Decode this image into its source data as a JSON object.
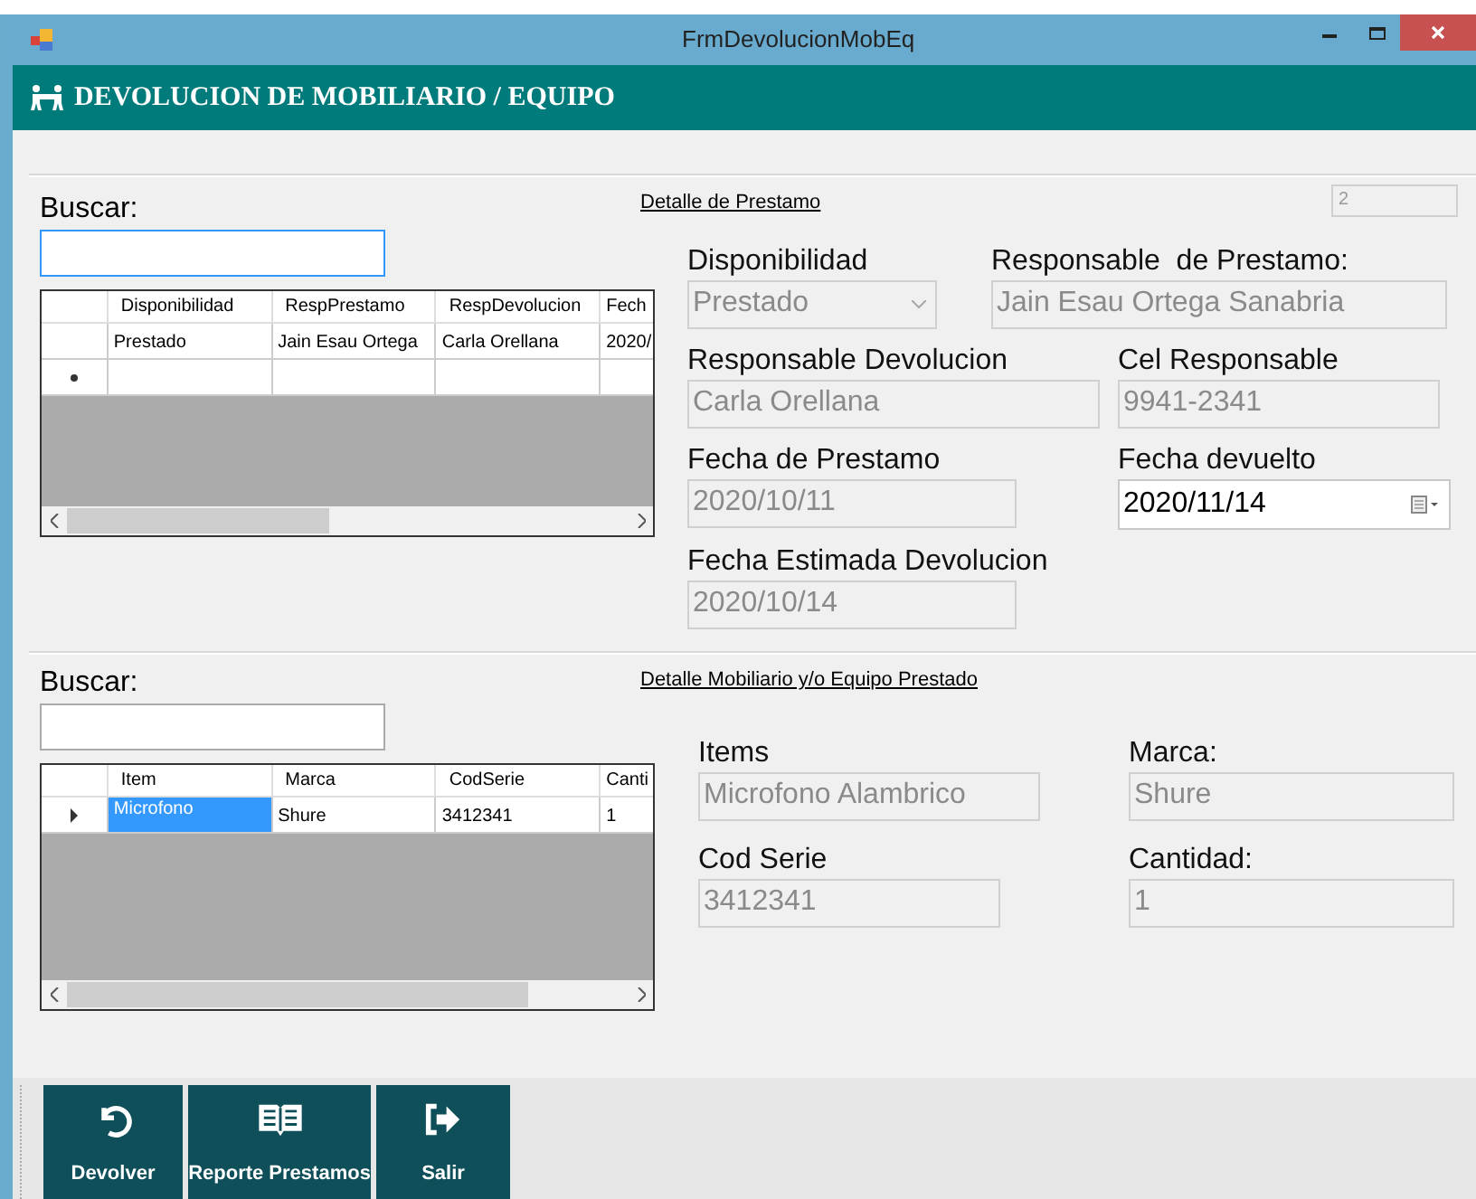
{
  "window": {
    "title": "FrmDevolucionMobEq"
  },
  "header": {
    "title": "DEVOLUCION DE MOBILIARIO / EQUIPO"
  },
  "panels": [
    {
      "search_label": "Buscar:",
      "link": "Detalle de Prestamo",
      "record_id": "2",
      "grid": {
        "columns": [
          "Disponibilidad",
          "RespPrestamo",
          "RespDevolucion",
          "Fech"
        ],
        "rows": [
          {
            "kind": "data",
            "current": false,
            "selected": false,
            "cells": [
              "Prestado",
              "Jain Esau Ortega",
              "Carla Orellana",
              "2020/"
            ]
          },
          {
            "kind": "new",
            "current": false,
            "selected": false,
            "cells": []
          }
        ]
      },
      "fields": [
        {
          "kind": "combo",
          "label": "Disponibilidad",
          "value": "Prestado",
          "disabled": true
        },
        {
          "kind": "text",
          "label": "Responsable  de Prestamo:",
          "value": "Jain Esau Ortega Sanabria",
          "disabled": true
        },
        {
          "kind": "text",
          "label": "Responsable Devolucion",
          "value": "Carla Orellana",
          "disabled": true
        },
        {
          "kind": "text",
          "label": "Cel Responsable",
          "value": "9941-2341",
          "disabled": true
        },
        {
          "kind": "text",
          "label": "Fecha de Prestamo",
          "value": "2020/10/11",
          "disabled": true
        },
        {
          "kind": "date",
          "label": "Fecha devuelto",
          "value": "2020/11/14",
          "disabled": false
        },
        {
          "kind": "text",
          "label": "Fecha Estimada Devolucion",
          "value": "2020/10/14",
          "disabled": true
        }
      ]
    },
    {
      "search_label": "Buscar:",
      "link": "Detalle Mobiliario y/o Equipo Prestado",
      "grid": {
        "columns": [
          "Item",
          "Marca",
          "CodSerie",
          "Canti"
        ],
        "rows": [
          {
            "kind": "data",
            "current": true,
            "selected": true,
            "cells": [
              "Microfono",
              "Shure",
              "3412341",
              "1"
            ]
          }
        ]
      },
      "fields": [
        {
          "kind": "text",
          "label": "Items",
          "value": "Microfono Alambrico",
          "disabled": true
        },
        {
          "kind": "text",
          "label": "Marca:",
          "value": "Shure",
          "disabled": true
        },
        {
          "kind": "text",
          "label": "Cod Serie",
          "value": "3412341",
          "disabled": true
        },
        {
          "kind": "text",
          "label": "Cantidad:",
          "value": "1",
          "disabled": true
        }
      ]
    }
  ],
  "toolbar": [
    {
      "kind": "undo",
      "label": "Devolver"
    },
    {
      "kind": "book",
      "label": "Reporte Prestamos"
    },
    {
      "kind": "exit",
      "label": "Salir"
    }
  ]
}
